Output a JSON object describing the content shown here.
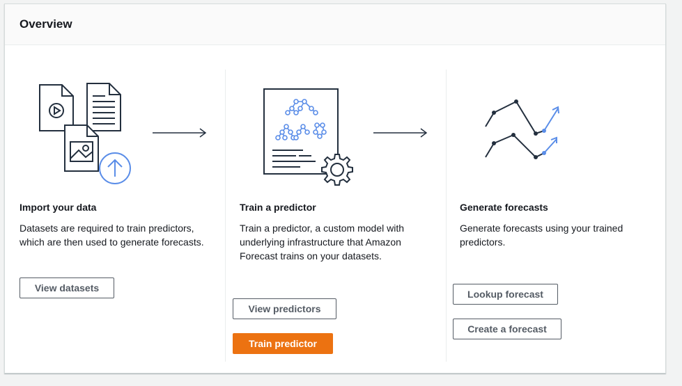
{
  "overview": {
    "title": "Overview"
  },
  "steps": [
    {
      "title": "Import your data",
      "description": "Datasets are required to train predictors, which are then used to generate forecasts.",
      "buttons": [
        "View datasets"
      ]
    },
    {
      "title": "Train a predictor",
      "description": "Train a predictor, a custom model with underlying infrastructure that Amazon Forecast trains on your datasets.",
      "buttons": [
        "View predictors",
        "Train predictor"
      ]
    },
    {
      "title": "Generate forecasts",
      "description": "Generate forecasts using your trained predictors.",
      "buttons": [
        "Lookup forecast",
        "Create a forecast"
      ]
    }
  ],
  "colors": {
    "accent_blue": "#5a8de8",
    "primary_orange": "#ec7211",
    "icon_dark": "#232f3e"
  },
  "icons": [
    "video-document-icon",
    "text-document-icon",
    "image-document-icon",
    "upload-icon",
    "arrow-right-icon",
    "model-document-icon",
    "gear-icon",
    "line-trend-icon"
  ]
}
